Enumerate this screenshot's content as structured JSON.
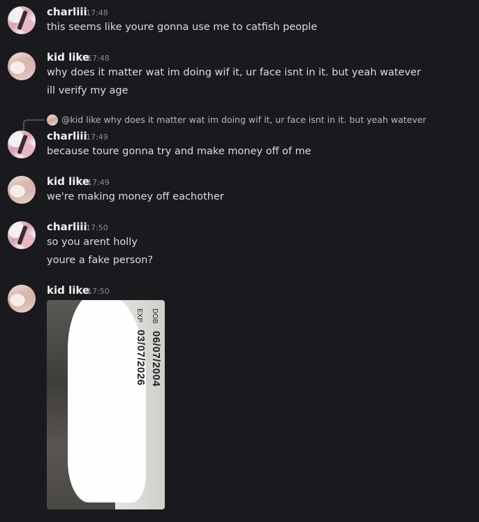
{
  "messages": [
    {
      "author": "charliii",
      "avatar": "charliii-avatar",
      "time": "17:48",
      "lines": [
        "this seems like youre gonna use me to catfish people"
      ]
    },
    {
      "author": "kid like",
      "avatar": "kid-like-avatar",
      "time": "17:48",
      "lines": [
        "why does it matter wat im doing wif it, ur face isnt in it. but yeah watever",
        "ill verify my age"
      ]
    },
    {
      "author": "charliii",
      "avatar": "charliii-avatar",
      "time": "17:49",
      "reply_to": {
        "mention": "@kid like",
        "text": "why does it matter wat im doing wif it, ur face isnt in it. but yeah watever"
      },
      "lines": [
        "because toure gonna try and make money off of me"
      ]
    },
    {
      "author": "kid like",
      "avatar": "kid-like-avatar",
      "time": "17:49",
      "lines": [
        "we're making money off eachother"
      ]
    },
    {
      "author": "charliii",
      "avatar": "charliii-avatar",
      "time": "17:50",
      "lines": [
        "so you arent holly",
        "youre a fake person?"
      ]
    },
    {
      "author": "kid like",
      "avatar": "kid-like-avatar",
      "time": "17:50",
      "attachment": {
        "type": "image",
        "card_labels": [
          "DOB",
          "EXP"
        ],
        "card_values": [
          "06/07/2004",
          "03/07/2026"
        ]
      }
    }
  ],
  "colors": {
    "background": "#1a1a1e",
    "username": "#f2f3f5",
    "message_text": "#dbdee1",
    "timestamp": "#8b8d94"
  }
}
